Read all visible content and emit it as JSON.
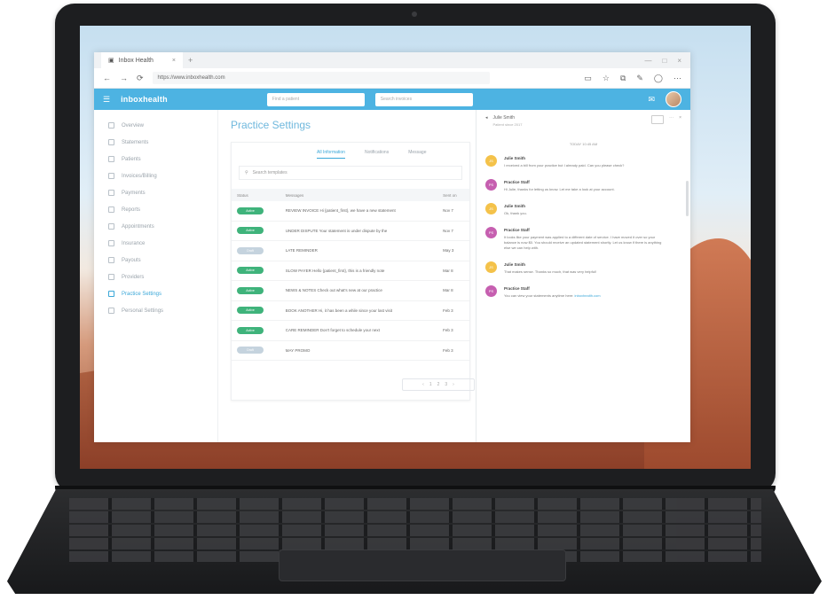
{
  "browser": {
    "tab_title": "Inbox Health",
    "tab_close": "×",
    "new_tab": "+",
    "window_controls": [
      "—",
      "□",
      "×"
    ],
    "url": "https://www.inboxhealth.com",
    "nav_icons": [
      "←",
      "→",
      "⟳"
    ],
    "tool_icons": [
      "▭",
      "☆",
      "⧉",
      "✎",
      "◯",
      "⋯"
    ]
  },
  "app": {
    "menu_icon": "☰",
    "brand": "inboxhealth",
    "search_placeholder_1": "Find a patient",
    "search_placeholder_2": "Search invoices",
    "header_icons": [
      "✉"
    ]
  },
  "sidebar": {
    "items": [
      {
        "label": "Overview",
        "active": false
      },
      {
        "label": "Statements",
        "active": false
      },
      {
        "label": "Patients",
        "active": false
      },
      {
        "label": "Invoices/Billing",
        "active": false
      },
      {
        "label": "Payments",
        "active": false
      },
      {
        "label": "Reports",
        "active": false
      },
      {
        "label": "Appointments",
        "active": false
      },
      {
        "label": "Insurance",
        "active": false
      },
      {
        "label": "Payouts",
        "active": false
      },
      {
        "label": "Providers",
        "active": false
      },
      {
        "label": "Practice Settings",
        "active": true
      },
      {
        "label": "Personal Settings",
        "active": false
      }
    ]
  },
  "main": {
    "title": "Practice Settings",
    "tabs": [
      {
        "label": "All Information",
        "active": true
      },
      {
        "label": "Notifications",
        "active": false
      },
      {
        "label": "Message",
        "active": false
      }
    ],
    "search_placeholder": "Search templates",
    "columns": [
      "Status",
      "Messages",
      "Sent on"
    ],
    "rows": [
      {
        "status": "Active",
        "message": "REVIEW INVOICE Hi {patient_first}, we have a new statement",
        "sent": "Nov 7"
      },
      {
        "status": "Active",
        "message": "UNDER DISPUTE Your statement is under dispute by the",
        "sent": "Nov 7"
      },
      {
        "status": "Draft",
        "message": "LATE REMINDER",
        "sent": "May 3"
      },
      {
        "status": "Active",
        "message": "SLOW PAYER Hello {patient_first}, this is a friendly note",
        "sent": "Mar 8"
      },
      {
        "status": "Active",
        "message": "NEWS & NOTES Check out what's new at our practice",
        "sent": "Mar 8"
      },
      {
        "status": "Active",
        "message": "BOOK ANOTHER Hi, it has been a while since your last visit",
        "sent": "Feb 3"
      },
      {
        "status": "Active",
        "message": "CARE REMINDER Don't forget to schedule your next",
        "sent": "Feb 3"
      },
      {
        "status": "Draft",
        "message": "MAY PROMO",
        "sent": "Feb 3"
      }
    ],
    "pager": [
      "‹",
      "1",
      "2",
      "3",
      "›"
    ]
  },
  "chat": {
    "name": "Julie Smith",
    "subtitle": "Patient since 2017",
    "date": "TODAY 10:45 AM",
    "messages": [
      {
        "initials": "JS",
        "color": "y",
        "name": "Julie Smith",
        "text": "I received a bill from your practice but I already paid. Can you please check?"
      },
      {
        "initials": "PS",
        "color": "p",
        "name": "Practice Staff",
        "text": "Hi Julie, thanks for letting us know. Let me take a look at your account."
      },
      {
        "initials": "JS",
        "color": "y",
        "name": "Julie Smith",
        "text": "Ok, thank you."
      },
      {
        "initials": "PS",
        "color": "p",
        "name": "Practice Staff",
        "text": "It looks like your payment was applied to a different date of service. I have moved it over so your balance is now $0. You should receive an updated statement shortly. Let us know if there is anything else we can help with."
      },
      {
        "initials": "JS",
        "color": "y",
        "name": "Julie Smith",
        "text": "That makes sense. Thanks so much, that was very helpful!"
      },
      {
        "initials": "PS",
        "color": "p",
        "name": "Practice Staff",
        "text": "You can view your statements anytime here:",
        "link": "inboxhealth.com"
      }
    ]
  },
  "colors": {
    "accent": "#4db3e2",
    "status_active": "#3fb37b",
    "status_draft": "#c5d3de",
    "avatar_yellow": "#f4c24a",
    "avatar_purple": "#c65fb0"
  }
}
